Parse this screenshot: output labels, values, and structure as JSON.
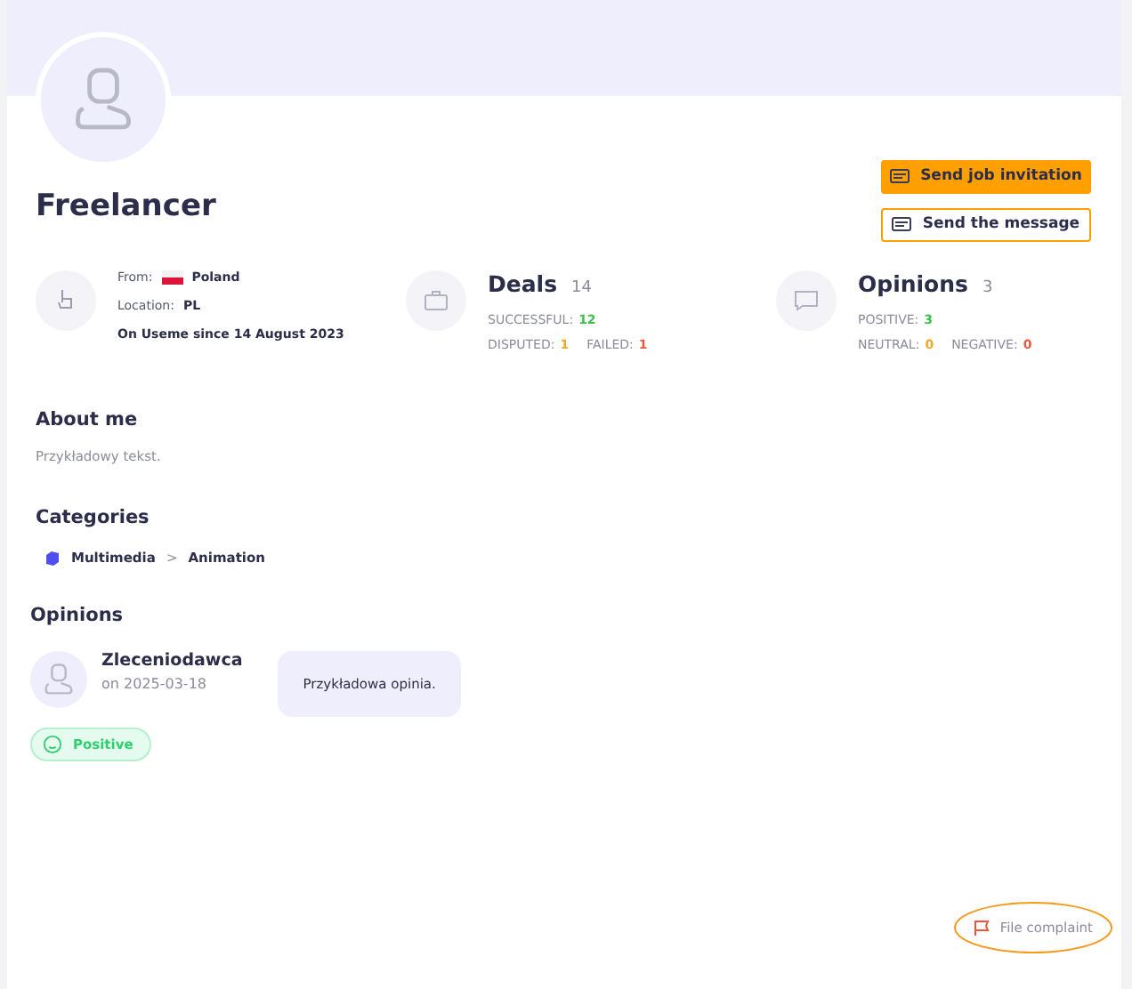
{
  "profile": {
    "name": "Freelancer"
  },
  "actions": [
    {
      "label": "Send job invitation",
      "kind": "primary"
    },
    {
      "label": "Send the message",
      "kind": "outline"
    }
  ],
  "info": {
    "from_label": "From:",
    "country": "Poland",
    "location_label": "Location:",
    "location": "PL",
    "since": "On Useme since 14 August 2023"
  },
  "deals": {
    "title": "Deals",
    "count": "14",
    "stats": [
      {
        "label": "SUCCESSFUL:",
        "value": "12",
        "color": "#3cc04a"
      },
      {
        "label": "DISPUTED:",
        "value": "1",
        "color": "#f5a623"
      },
      {
        "label": "FAILED:",
        "value": "1",
        "color": "#f0553a"
      }
    ]
  },
  "opinions_summary": {
    "title": "Opinions",
    "count": "3",
    "stats": [
      {
        "label": "POSITIVE:",
        "value": "3",
        "color": "#3cc04a"
      },
      {
        "label": "NEUTRAL:",
        "value": "0",
        "color": "#f5a623"
      },
      {
        "label": "NEGATIVE:",
        "value": "0",
        "color": "#f0553a"
      }
    ]
  },
  "about": {
    "title": "About me",
    "text": "Przykładowy tekst."
  },
  "categories": {
    "title": "Categories",
    "items": [
      {
        "parent": "Multimedia",
        "separator": ">",
        "child": "Animation"
      }
    ]
  },
  "opinions": {
    "title": "Opinions",
    "items": [
      {
        "author": "Zleceniodawca",
        "date": "on 2025-03-18",
        "text": "Przykładowa opinia.",
        "rating": "Positive",
        "kind": "positive"
      }
    ]
  },
  "complaint": {
    "label": "File complaint",
    "highlighted": true
  }
}
